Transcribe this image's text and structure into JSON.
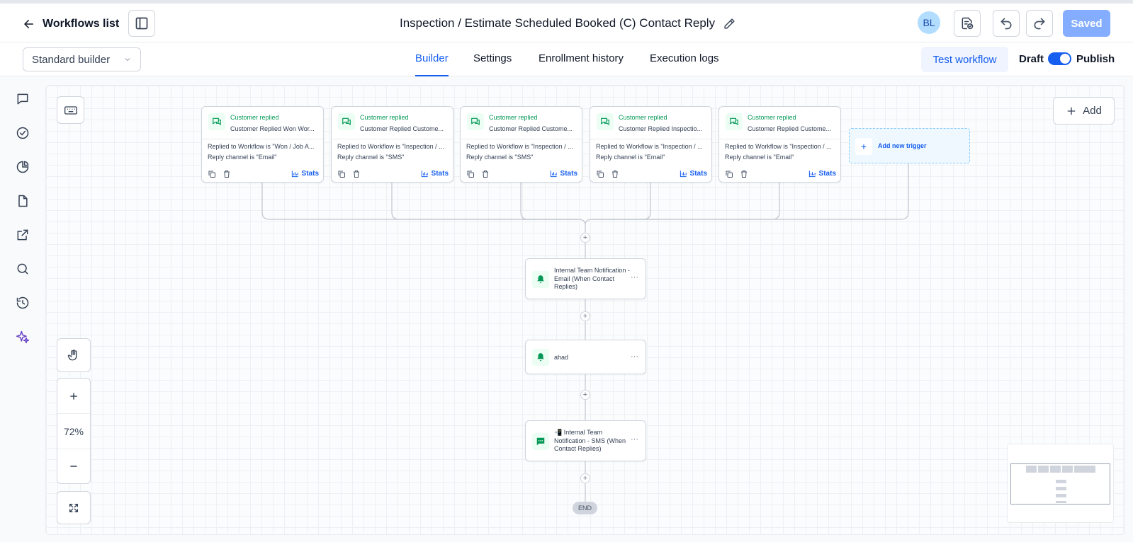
{
  "header": {
    "back_label": "Workflows list",
    "title": "Inspection / Estimate Scheduled Booked (C) Contact Reply",
    "avatar_initials": "BL",
    "saved_label": "Saved"
  },
  "subbar": {
    "builder_select": "Standard builder",
    "tabs": [
      "Builder",
      "Settings",
      "Enrollment history",
      "Execution logs"
    ],
    "active_tab": "Builder",
    "test_workflow": "Test workflow",
    "draft_label": "Draft",
    "publish_label": "Publish",
    "publish_on": true
  },
  "sidebar": {
    "icons": [
      "chat-icon",
      "check-circle-icon",
      "pie-chart-icon",
      "document-icon",
      "external-link-icon",
      "search-icon",
      "history-icon",
      "sparkles-icon"
    ]
  },
  "canvas": {
    "add_label": "Add",
    "zoom_level": "72%",
    "add_trigger_label": "Add new trigger",
    "end_label": "END",
    "triggers": [
      {
        "type": "Customer replied",
        "name": "Customer Replied Won Wor...",
        "cond1": "Replied to Workflow is \"Won / Job A...",
        "cond2": "Reply channel is \"Email\"",
        "stats": "Stats"
      },
      {
        "type": "Customer replied",
        "name": "Customer Replied Custome...",
        "cond1": "Replied to Workflow is \"Inspection / ...",
        "cond2": "Reply channel is \"SMS\"",
        "stats": "Stats"
      },
      {
        "type": "Customer replied",
        "name": "Customer Replied Custome...",
        "cond1": "Replied to Workflow is \"Inspection / ...",
        "cond2": "Reply channel is \"SMS\"",
        "stats": "Stats"
      },
      {
        "type": "Customer replied",
        "name": "Customer Replied Inspectio...",
        "cond1": "Replied to Workflow is \"Inspection / ...",
        "cond2": "Reply channel is \"Email\"",
        "stats": "Stats"
      },
      {
        "type": "Customer replied",
        "name": "Customer Replied Custome...",
        "cond1": "Replied to Workflow is \"Inspection / ...",
        "cond2": "Reply channel is \"Email\"",
        "stats": "Stats"
      }
    ],
    "actions": [
      {
        "label": "Internal Team Notification - Email (When Contact Replies)",
        "icon": "bell-icon"
      },
      {
        "label": "ahad",
        "icon": "bell-icon"
      },
      {
        "label": "📲 Internal Team Notification - SMS (When Contact Replies)",
        "icon": "sms-icon"
      }
    ]
  },
  "colors": {
    "accent": "#155eef",
    "trigger_green": "#039855",
    "saved_bg": "#84adff"
  }
}
